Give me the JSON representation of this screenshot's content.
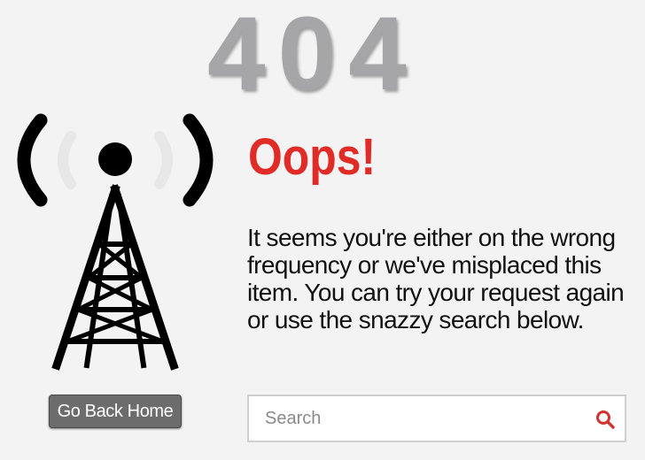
{
  "error": {
    "code": "404",
    "headline": "Oops!",
    "message": "It seems you're either on the wrong frequency or we've misplaced this item. You can try your request again or use the snazzy search below."
  },
  "actions": {
    "home_button_label": "Go Back Home"
  },
  "search": {
    "placeholder": "Search",
    "value": ""
  },
  "icons": {
    "illustration": "radio-tower-icon",
    "search": "search-icon"
  },
  "colors": {
    "background": "#f3f3f3",
    "code": "#a6a6a9",
    "headline": "#e12b27",
    "button": "#6c6c6c",
    "search_icon": "#d2332f"
  }
}
